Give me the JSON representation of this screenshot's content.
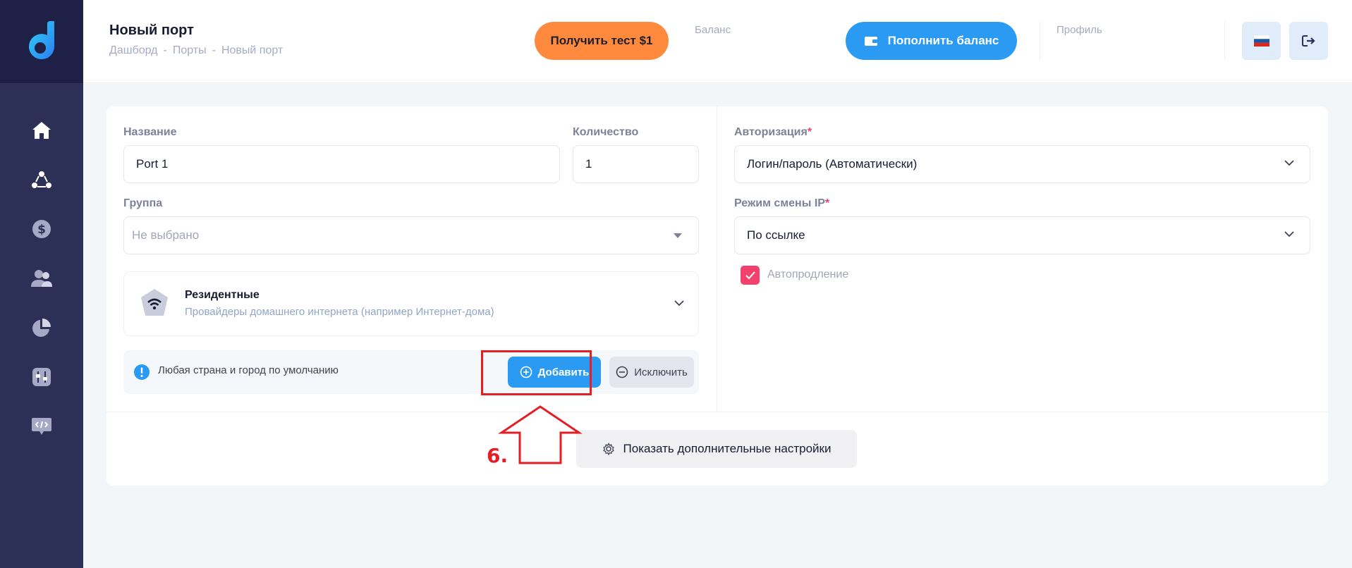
{
  "header": {
    "page_title": "Новый порт",
    "breadcrumb": [
      "Дашборд",
      "Порты",
      "Новый порт"
    ],
    "breadcrumb_sep": "-",
    "test_button": "Получить тест $1",
    "balance_label": "Баланс",
    "topup_button": "Пополнить баланс",
    "profile_label": "Профиль"
  },
  "sidebar": {
    "items": [
      "home-icon",
      "network-icon",
      "dollar-icon",
      "users-icon",
      "pie-chart-icon",
      "settings-sliders-icon",
      "code-chat-icon"
    ]
  },
  "form": {
    "name_label": "Название",
    "name_value": "Port 1",
    "qty_label": "Количество",
    "qty_value": "1",
    "group_label": "Группа",
    "group_placeholder": "Не выбрано",
    "residential_title": "Резидентные",
    "residential_sub": "Провайдеры домашнего интернета (например Интернет-дома)",
    "info_text": "Любая страна и город по умолчанию",
    "add_button": "Добавить",
    "exclude_button": "Исключить",
    "auth_label": "Авторизация",
    "required_mark": "*",
    "auth_value": "Логин/пароль (Автоматически)",
    "ip_mode_label": "Режим смены IP",
    "ip_mode_value": "По ссылке",
    "autorenew_label": "Автопродление",
    "autorenew_checked": true,
    "more_settings_button": "Показать дополнительные настройки"
  },
  "annotation": {
    "step_label": "6."
  },
  "colors": {
    "sidebar": "#2d3056",
    "accent_blue": "#2b9af3",
    "accent_orange": "#ff8a3d",
    "checkbox": "#f1416c",
    "annotation_red": "#e31e24"
  }
}
